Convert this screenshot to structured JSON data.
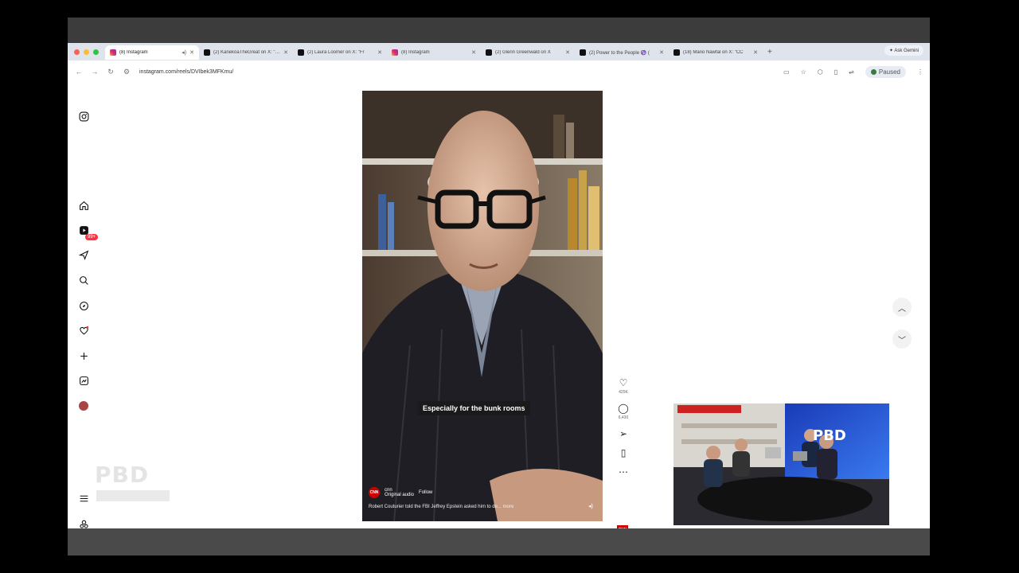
{
  "tabs": [
    {
      "title": "(8) Instagram",
      "favicon": "instagram",
      "active": true
    },
    {
      "title": "(2) KanekoaTheGreat on X: \"Ro",
      "favicon": "x",
      "active": false
    },
    {
      "title": "(2) Laura Loomer on X: \"Fr",
      "favicon": "x",
      "active": false
    },
    {
      "title": "(8) Instagram",
      "favicon": "instagram",
      "active": false
    },
    {
      "title": "(2) Glenn Greenwald on X",
      "favicon": "x",
      "active": false
    },
    {
      "title": "(2) Power to the People ♑ (",
      "favicon": "x",
      "active": false
    },
    {
      "title": "(18) Mario Nawfal on X: \"CC",
      "favicon": "x",
      "active": false
    }
  ],
  "ask_gemini": "Ask Gemini",
  "url": "instagram.com/reels/DVIbek3MFKmu/",
  "paused_label": "Paused",
  "sidebar": {
    "notification_count": "99+"
  },
  "watermark": "PBD",
  "reel": {
    "caption": "Especially for the bunk rooms",
    "account": "cnn",
    "audio": "Original audio",
    "follow_label": "Follow",
    "description": "Robert Couturier told the FBI Jeffrey Epstein asked him to de...",
    "more_label": "more",
    "likes": "425K",
    "comments": "6,430"
  },
  "pip": {
    "logo_text": "PBD"
  },
  "colors": {
    "accent": "#0095f6",
    "badge": "#ff3040",
    "cnn_red": "#cc0000"
  }
}
